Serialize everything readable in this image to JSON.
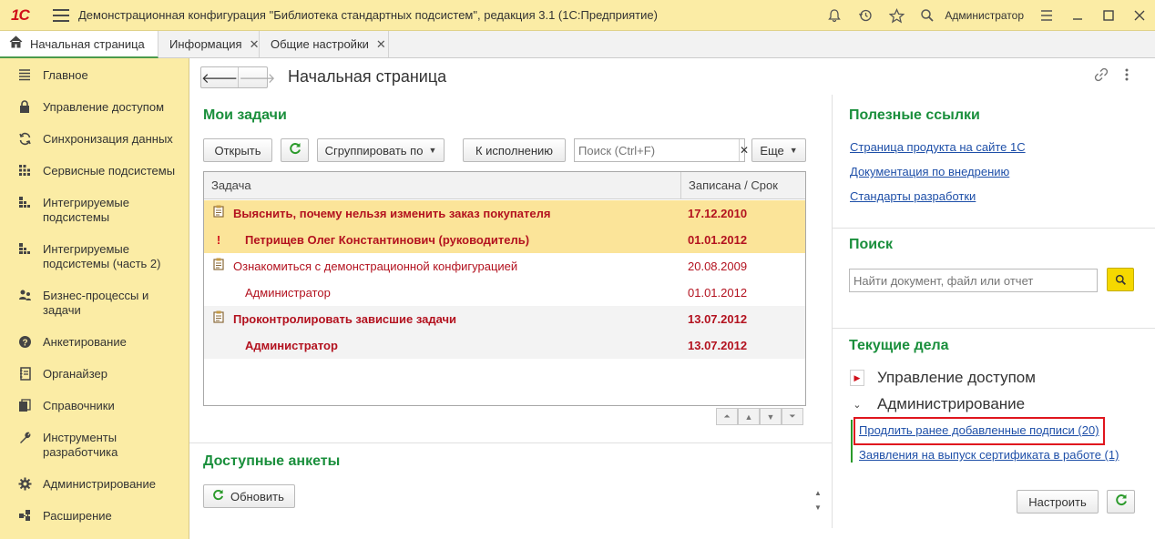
{
  "titlebar": {
    "logo": "1С",
    "title": "Демонстрационная конфигурация \"Библиотека стандартных подсистем\", редакция 3.1  (1С:Предприятие)",
    "user": "Администратор"
  },
  "tabs": [
    {
      "label": "Начальная страница"
    },
    {
      "label": "Информация"
    },
    {
      "label": "Общие настройки"
    }
  ],
  "sidebar": {
    "items": [
      {
        "label": "Главное",
        "icon": "menu-icon"
      },
      {
        "label": "Управление доступом",
        "icon": "lock-icon"
      },
      {
        "label": "Синхронизация данных",
        "icon": "sync-icon"
      },
      {
        "label": "Сервисные подсистемы",
        "icon": "grid-icon"
      },
      {
        "label": "Интегрируемые подсистемы",
        "icon": "blocks-icon"
      },
      {
        "label": "Интегрируемые подсистемы (часть 2)",
        "icon": "blocks-icon"
      },
      {
        "label": "Бизнес-процессы и задачи",
        "icon": "users-icon"
      },
      {
        "label": "Анкетирование",
        "icon": "question-icon"
      },
      {
        "label": "Органайзер",
        "icon": "notebook-icon"
      },
      {
        "label": "Справочники",
        "icon": "books-icon"
      },
      {
        "label": "Инструменты разработчика",
        "icon": "wrench-icon"
      },
      {
        "label": "Администрирование",
        "icon": "gear-icon"
      },
      {
        "label": "Расширение",
        "icon": "extension-icon"
      }
    ]
  },
  "page": {
    "title": "Начальная страница"
  },
  "my_tasks": {
    "title": "Мои задачи",
    "open_label": "Открыть",
    "group_label": "Сгруппировать по",
    "execute_label": "К исполнению",
    "search_placeholder": "Поиск (Ctrl+F)",
    "more_label": "Еще",
    "columns": [
      "Задача",
      "Записана / Срок"
    ],
    "rows": [
      {
        "task": "Выяснить, почему нельзя изменить заказ покупателя",
        "date": "17.12.2010"
      },
      {
        "task": "Петрищев Олег Константинович (руководитель)",
        "date": "01.01.2012"
      },
      {
        "task": "Ознакомиться с демонстрационной конфигурацией",
        "date": "20.08.2009"
      },
      {
        "task": "Администратор",
        "date": "01.01.2012"
      },
      {
        "task": "Проконтролировать зависшие задачи",
        "date": "13.07.2012"
      },
      {
        "task": "Администратор",
        "date": "13.07.2012"
      }
    ]
  },
  "surveys": {
    "title": "Доступные анкеты",
    "refresh_label": "Обновить"
  },
  "useful_links": {
    "title": "Полезные ссылки",
    "links": [
      "Страница продукта на сайте 1С",
      "Документация по внедрению",
      "Стандарты разработки"
    ]
  },
  "search": {
    "title": "Поиск",
    "placeholder": "Найти документ, файл или отчет"
  },
  "current_tasks": {
    "title": "Текущие дела",
    "groups": [
      {
        "label": "Управление доступом"
      },
      {
        "label": "Администрирование"
      }
    ],
    "links": [
      "Продлить ранее добавленные подписи (20)",
      "Заявления на выпуск сертификата в работе (1)"
    ],
    "configure_label": "Настроить"
  },
  "colors": {
    "accent_green": "#1a8f3c",
    "panel_yellow": "#fbeca5",
    "task_red": "#b3121f",
    "highlight_box": "#e0161e"
  }
}
